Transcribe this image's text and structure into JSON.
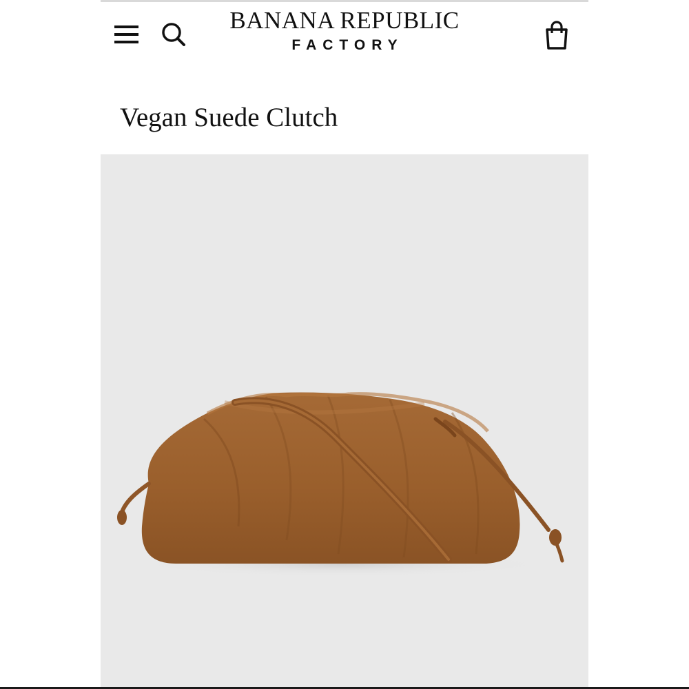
{
  "header": {
    "menu_icon": "hamburger-menu-icon",
    "search_icon": "search-icon",
    "bag_icon": "shopping-bag-icon",
    "logo_line1": "BANANA REPUBLIC",
    "logo_line2": "FACTORY"
  },
  "product": {
    "title": "Vegan Suede Clutch",
    "image_background": "#e9e9e9",
    "bag_color": "#9a5f2c"
  }
}
